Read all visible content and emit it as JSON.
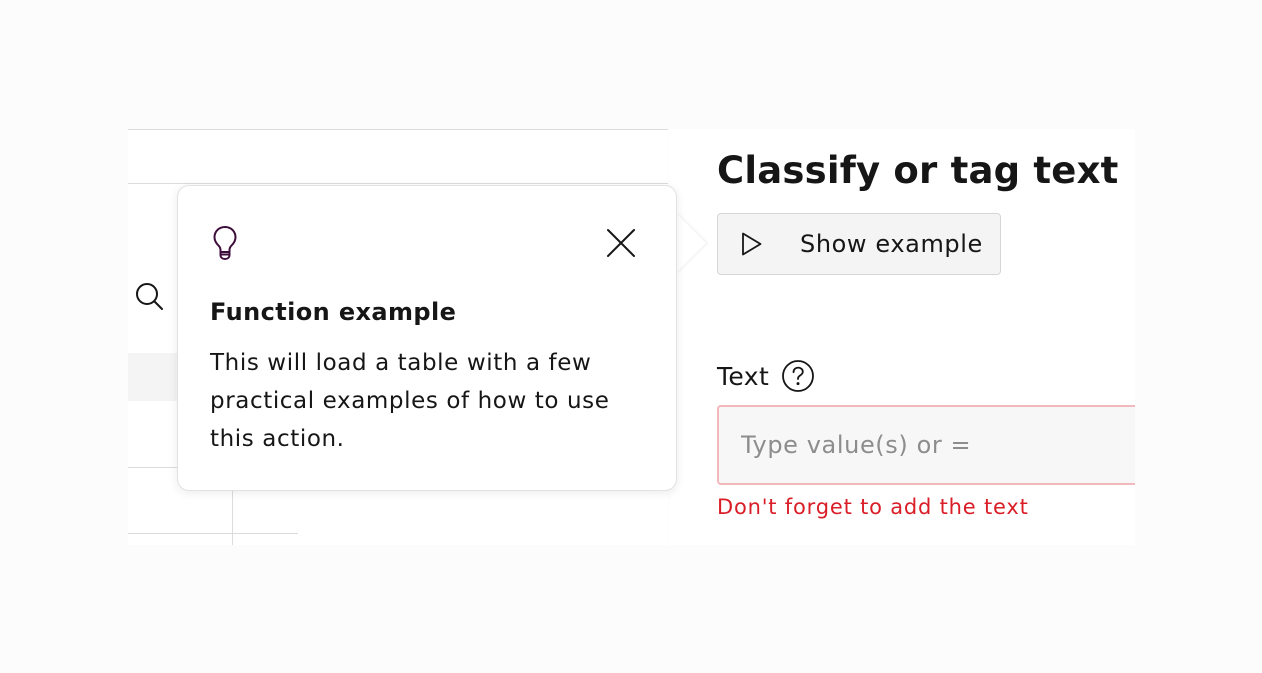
{
  "panel": {
    "title": "Classify or tag text",
    "show_example_label": "Show example",
    "field_label": "Text",
    "input_placeholder": "Type value(s) or =",
    "error_message": "Don't forget to add the text"
  },
  "popover": {
    "title": "Function example",
    "body": "This will load a table with a few practical examples of how to use this action."
  },
  "icons": {
    "search": "search-icon",
    "bulb": "lightbulb-icon",
    "close": "close-icon",
    "play": "play-icon",
    "help": "help-icon"
  },
  "colors": {
    "text": "#161616",
    "error": "#da1e28",
    "error_border": "#f2b8bc",
    "bulb": "#3d0e3a",
    "button_bg": "#f4f4f4"
  }
}
